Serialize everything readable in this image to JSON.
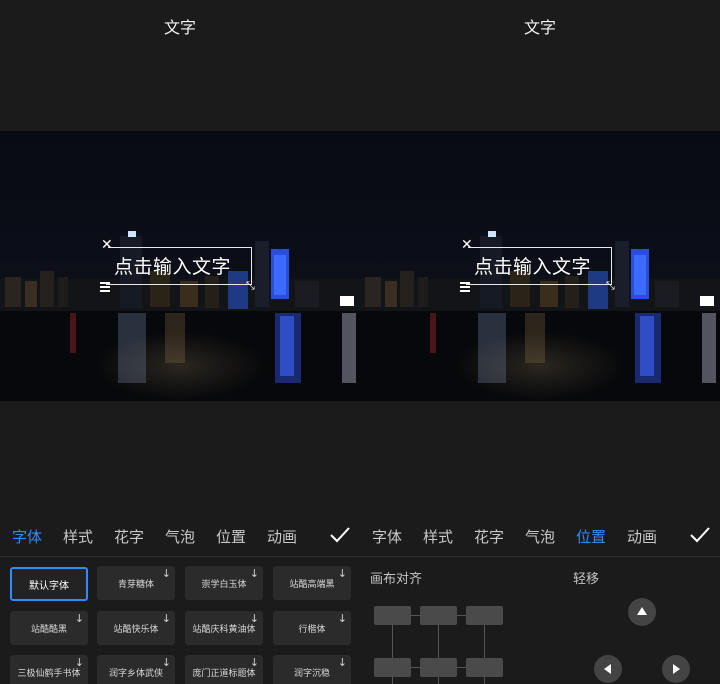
{
  "left": {
    "title": "文字",
    "textbox_placeholder": "点击输入文字",
    "tabs": [
      {
        "label": "字体",
        "active": true
      },
      {
        "label": "样式",
        "active": false
      },
      {
        "label": "花字",
        "active": false
      },
      {
        "label": "气泡",
        "active": false
      },
      {
        "label": "位置",
        "active": false
      },
      {
        "label": "动画",
        "active": false
      }
    ],
    "fonts": [
      {
        "label": "默认字体",
        "selected": true,
        "download": false
      },
      {
        "label": "青芽糖体",
        "selected": false,
        "download": true
      },
      {
        "label": "崇学白玉体",
        "selected": false,
        "download": true
      },
      {
        "label": "站酷高端黑",
        "selected": false,
        "download": true
      },
      {
        "label": "站酷酷黑",
        "selected": false,
        "download": true
      },
      {
        "label": "站酷快乐体",
        "selected": false,
        "download": true
      },
      {
        "label": "站酷庆科黄油体",
        "selected": false,
        "download": true
      },
      {
        "label": "行楷体",
        "selected": false,
        "download": true
      },
      {
        "label": "三极仙鹤手书体",
        "selected": false,
        "download": true
      },
      {
        "label": "润字乡体武侠",
        "selected": false,
        "download": true
      },
      {
        "label": "庞门正道标题体",
        "selected": false,
        "download": true
      },
      {
        "label": "润字沉稳",
        "selected": false,
        "download": true
      }
    ]
  },
  "right": {
    "title": "文字",
    "textbox_placeholder": "点击输入文字",
    "tabs": [
      {
        "label": "字体",
        "active": false
      },
      {
        "label": "样式",
        "active": false
      },
      {
        "label": "花字",
        "active": false
      },
      {
        "label": "气泡",
        "active": false
      },
      {
        "label": "位置",
        "active": true
      },
      {
        "label": "动画",
        "active": false
      }
    ],
    "canvas_align_label": "画布对齐",
    "nudge_label": "轻移"
  },
  "colors": {
    "accent": "#2f8cff",
    "background": "#1b1b1b"
  },
  "icons": {
    "confirm": "check-icon",
    "close": "close-icon",
    "menu": "menu-icon",
    "resize": "resize-icon",
    "download": "download-icon",
    "up": "arrow-up-icon",
    "left": "arrow-left-icon",
    "right": "arrow-right-icon"
  }
}
